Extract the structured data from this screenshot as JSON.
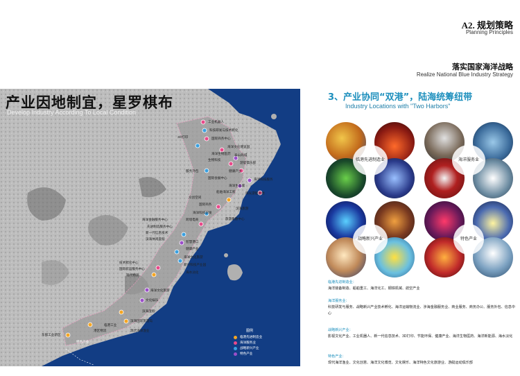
{
  "header": {
    "code": "A2. 规划策略",
    "code_en": "Planning Principles",
    "section": "落实国家海洋战略",
    "section_en": "Realize National Blue Industry Strategy"
  },
  "map": {
    "title": "产业因地制宜，星罗棋布",
    "subtitle": "Develop Industry According To Local Condition",
    "labels": [
      "工业机器人",
      "科技研发与技术孵化",
      "3D打印",
      "国际商务中心",
      "海洋文化博览园",
      "海洋生物医药",
      "生物科技",
      "泰山商城",
      "游艇俱乐部",
      "服务外包",
      "健康产业",
      "海洋科技服务",
      "国际会展中心",
      "海洋生态城",
      "船舶海洋工程",
      "阳光游艇基地",
      "众创空间",
      "国际商务",
      "滨海旅游",
      "海洋科技研发",
      "旅游集散中心",
      "跨境电商",
      "海洋金融服务中心",
      "先进制造服务中心",
      "新一代信息技术",
      "滨海休闲度假",
      "智慧港口",
      "健康产业",
      "海洋文化旅游",
      "新兴科技产业园",
      "海水淡化",
      "技术孵化中心",
      "国际航运服务中心",
      "现代物流",
      "海洋文化旅游",
      "文化娱乐",
      "滨海度假",
      "滨海国际旅游岛",
      "现代海洋渔业",
      "临港工业",
      "港区物流",
      "东部工业新区",
      "特色产业"
    ],
    "legend": {
      "title": "图例",
      "items": [
        {
          "label": "临港先进制造业",
          "color": "#f5a623"
        },
        {
          "label": "海洋服务业",
          "color": "#e84a8a"
        },
        {
          "label": "战略新兴产业",
          "color": "#3aa0e0"
        },
        {
          "label": "特色产业",
          "color": "#9b4fc9"
        }
      ]
    }
  },
  "right": {
    "title": "3、产业协同“双港”，陆海统筹纽带",
    "subtitle": "Industry Locations with \"Two Harbors\"",
    "clusters": [
      {
        "center": "临港先进制造业"
      },
      {
        "center": "海洋服务业"
      },
      {
        "center": "战略新兴产业"
      },
      {
        "center": "特色产业"
      }
    ],
    "categories": [
      {
        "heading": "临港先进制造业：",
        "body": "海洋装备制造、船舶重工、海洋化工、钢铁机械、航空产业"
      },
      {
        "heading": "海洋服务业：",
        "body": "科技研发与服务、战略新兴产业技术孵化、海洋运输物流业、涉海金融服务业、商业服务、商务办公、服务外包、信息中心"
      },
      {
        "heading": "战略新兴产业：",
        "body": "影视文化产业、工业机器人、新一代信息技术、3D打印、节能环保、健康产业、海洋生物医药、海洋新能源、海水淡化"
      },
      {
        "heading": "特色产业：",
        "body": "现代海洋渔业、文化创意、海洋文化博览、文化娱乐、海洋特色文化旅游业、游艇运动俱乐部"
      }
    ]
  },
  "colors": {
    "accent": "#1d8fbd",
    "sea": "#123d84"
  }
}
